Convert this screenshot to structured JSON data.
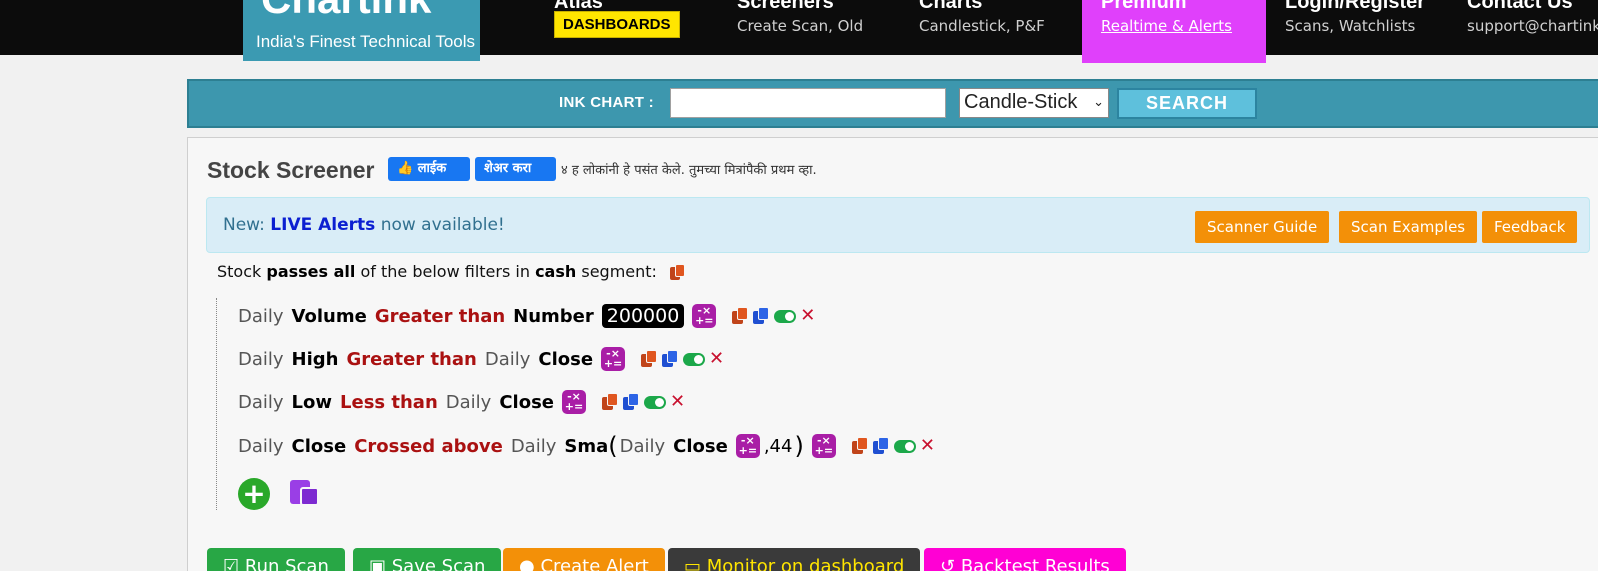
{
  "navbar": {
    "logo_title": "Chartink",
    "logo_tagline": "India's Finest Technical Tools",
    "items": [
      {
        "head": "Atlas",
        "badge": "DASHBOARDS"
      },
      {
        "head": "Screeners",
        "sub": "Create Scan, Old"
      },
      {
        "head": "Charts",
        "sub": "Candlestick, P&F"
      },
      {
        "head": "Premium",
        "sub": "Realtime & Alerts"
      },
      {
        "head": "Login/Register",
        "sub": "Scans, Watchlists"
      },
      {
        "head": "Contact Us",
        "sub": "support@chartink"
      }
    ],
    "premium_color": "#e040fb"
  },
  "search": {
    "label": "INK CHART :",
    "input_value": "",
    "select_value": "Candle-Stick",
    "button": "SEARCH"
  },
  "screener": {
    "title": "Stock Screener",
    "fb_like": "लाईक",
    "fb_share": "शेअर करा",
    "fb_text": "४ ह लोकांनी हे पसंत केले. तुमच्या मित्रांपैकी प्रथम व्हा."
  },
  "alert": {
    "prefix": "New:",
    "highlight": "LIVE Alerts",
    "suffix": "now available!",
    "buttons": [
      "Scanner Guide",
      "Scan Examples",
      "Feedback"
    ]
  },
  "description": {
    "t1": "Stock",
    "t2": "passes all",
    "t3": "of the below filters in",
    "t4": "cash",
    "t5": "segment:"
  },
  "filters": [
    {
      "p1": "Daily",
      "p2": "Volume",
      "op": "Greater than",
      "p3": "Number",
      "num": "200000"
    },
    {
      "p1": "Daily",
      "p2": "High",
      "op": "Greater than",
      "p3": "Daily",
      "p4": "Close"
    },
    {
      "p1": "Daily",
      "p2": "Low",
      "op": "Less than",
      "p3": "Daily",
      "p4": "Close"
    },
    {
      "p1": "Daily",
      "p2": "Close",
      "op": "Crossed above",
      "p3": "Daily",
      "p4": "Sma",
      "open": "(",
      "p5": "Daily",
      "p6": "Close",
      "arg": ",44",
      "close": ")"
    }
  ],
  "bottom_buttons": [
    "Run Scan",
    "Save Scan",
    "Create Alert",
    "Monitor on dashboard",
    "Backtest Results"
  ],
  "colors": {
    "accent_teal": "#3b9ab2",
    "orange": "#f39008",
    "operator_red": "#a11111",
    "calc_purple": "#a91ea6"
  }
}
